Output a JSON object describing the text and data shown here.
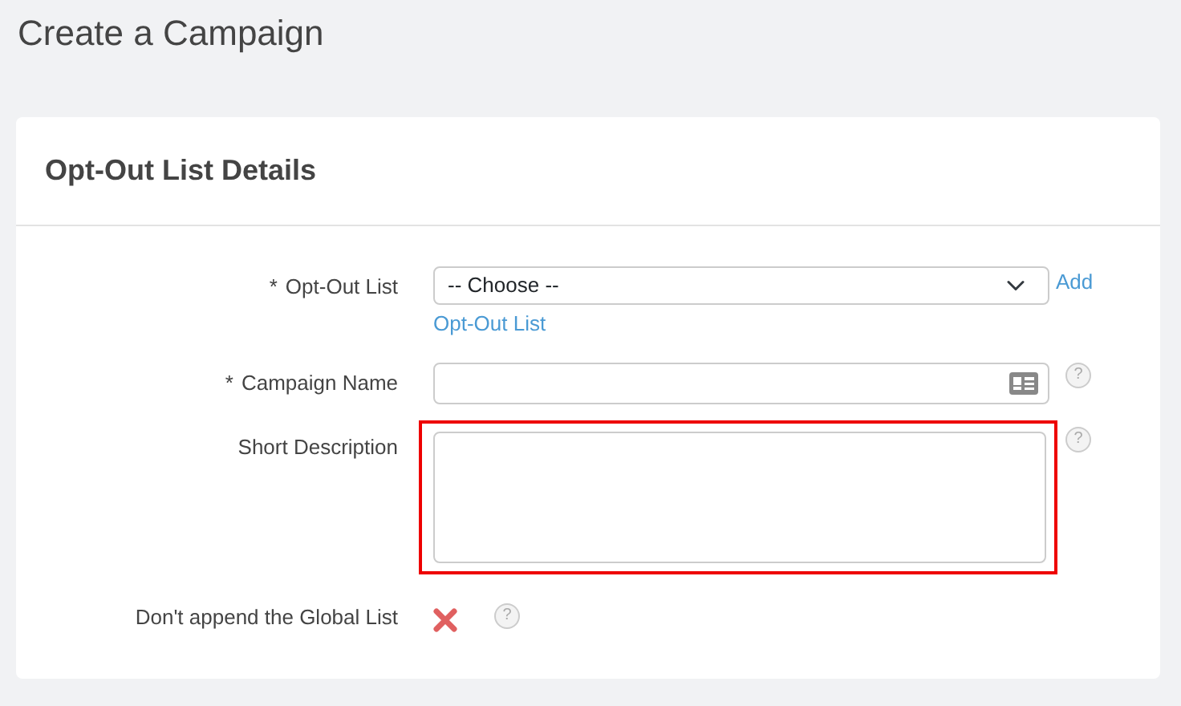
{
  "page_title": "Create a Campaign",
  "card": {
    "title": "Opt-Out List Details",
    "fields": [
      {
        "kind": "select",
        "required_mark": "*",
        "label": "Opt-Out List",
        "value": "-- Choose --",
        "link_parts": [
          "Add",
          "Opt-Out List"
        ]
      },
      {
        "kind": "text",
        "required_mark": "*",
        "label": "Campaign Name",
        "help": "?"
      },
      {
        "kind": "textarea",
        "label": "Short Description",
        "highlighted": true,
        "help": "?"
      },
      {
        "kind": "toggle",
        "label": "Don't append the Global List",
        "checked": false,
        "help": "?"
      }
    ]
  }
}
